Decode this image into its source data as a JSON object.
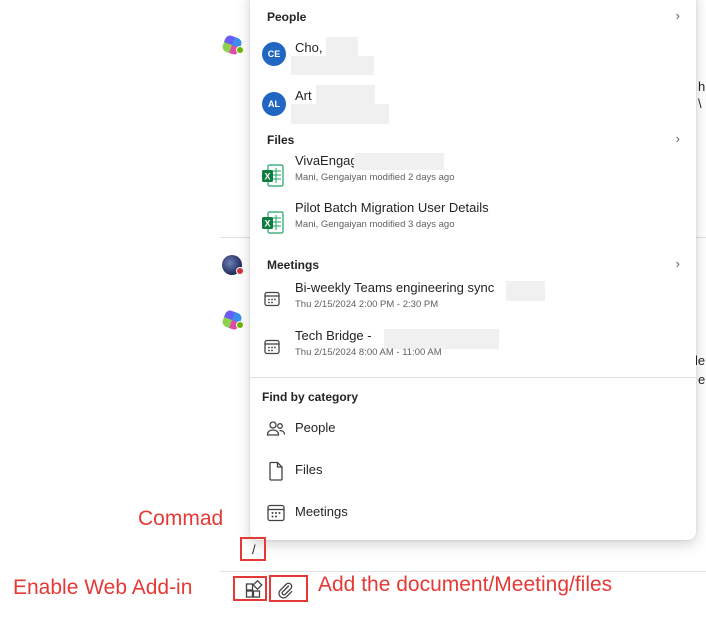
{
  "popup": {
    "people": {
      "title": "People",
      "items": [
        {
          "initials": "CE",
          "name": "Cho,",
          "color": "#2266c4"
        },
        {
          "initials": "AL",
          "name": "Art",
          "color": "#2266c4"
        }
      ]
    },
    "files": {
      "title": "Files",
      "items": [
        {
          "name": "VivaEngag",
          "meta": "Mani, Gengaiyan modified 2 days ago",
          "icon": "excel-icon"
        },
        {
          "name": "Pilot Batch Migration User Details",
          "meta": "Mani, Gengaiyan modified 3 days ago",
          "icon": "excel-icon"
        }
      ]
    },
    "meetings": {
      "title": "Meetings",
      "items": [
        {
          "name": "Bi-weekly Teams engineering sync",
          "meta": "Thu 2/15/2024 2:00 PM - 2:30 PM",
          "icon": "calendar-icon"
        },
        {
          "name": "Tech Bridge -",
          "meta": "Thu 2/15/2024 8:00 AM - 11:00 AM",
          "icon": "calendar-icon"
        }
      ]
    },
    "categories": {
      "title": "Find by category",
      "items": [
        {
          "label": "People",
          "icon": "people-icon"
        },
        {
          "label": "Files",
          "icon": "file-icon"
        },
        {
          "label": "Meetings",
          "icon": "calendar-icon"
        }
      ]
    }
  },
  "composer": {
    "input_value": "/"
  },
  "background": {
    "fragments": [
      "h",
      "\\",
      "le",
      "e"
    ]
  },
  "annotations": {
    "command": "Commad",
    "web_addin": "Enable Web Add-in",
    "attach": "Add the document/Meeting/files",
    "color": "#e53935"
  }
}
